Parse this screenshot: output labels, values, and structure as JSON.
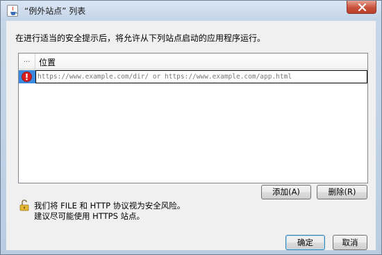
{
  "window": {
    "title": "“例外站点” 列表",
    "icon": "java-cup-icon",
    "close_icon": "close-icon"
  },
  "prompt": "在进行适当的安全提示后，将允许从下列站点启动的应用程序运行。",
  "list": {
    "columns": [
      "...",
      "位置"
    ],
    "rows": [
      {
        "status_icon": "error-icon",
        "location_value": "",
        "location_placeholder": "https://www.example.com/dir/ or https://www.example.com/app.html"
      }
    ]
  },
  "buttons": {
    "add": "添加(A)",
    "remove": "删除(R)",
    "ok": "确定",
    "cancel": "取消"
  },
  "warning": {
    "icon": "unlocked-padlock-icon",
    "line1": "我们将 FILE 和 HTTP 协议视为安全风险。",
    "line2": "建议尽可能使用 HTTPS 站点。"
  },
  "colors": {
    "selected_row": "#3b8ae0",
    "close_button": "#c8513c",
    "error_icon": "#d81e1e"
  }
}
